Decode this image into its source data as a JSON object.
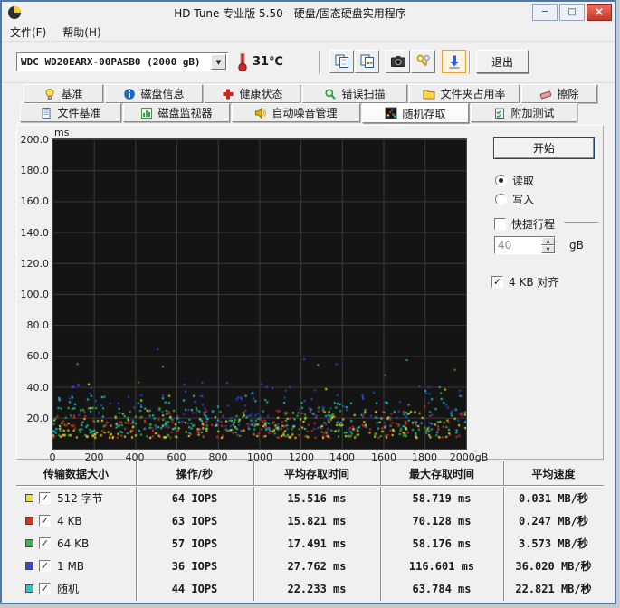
{
  "window": {
    "title": "HD Tune 专业版 5.50 - 硬盘/固态硬盘实用程序",
    "controls": {
      "minimize": "─",
      "maximize": "□",
      "close": "×"
    }
  },
  "menubar": {
    "items": [
      {
        "label": "文件(F)"
      },
      {
        "label": "帮助(H)"
      }
    ]
  },
  "toolbar": {
    "drive_selected": "WDC WD20EARX-00PASB0 (2000 gB)",
    "temperature": "31℃",
    "exit_label": "退出"
  },
  "icons": {
    "check": "✓",
    "dropdown_arrow": "▼",
    "spin_up": "▲",
    "spin_down": "▼"
  },
  "tabs": {
    "active": "随机存取",
    "row1": [
      {
        "label": "基准"
      },
      {
        "label": "磁盘信息"
      },
      {
        "label": "健康状态"
      },
      {
        "label": "错误扫描"
      },
      {
        "label": "文件夹占用率"
      },
      {
        "label": "擦除"
      }
    ],
    "row2": [
      {
        "label": "文件基准"
      },
      {
        "label": "磁盘监视器"
      },
      {
        "label": "自动噪音管理"
      },
      {
        "label": "随机存取"
      },
      {
        "label": "附加测试"
      }
    ]
  },
  "side_panel": {
    "start_label": "开始",
    "mode": "read",
    "read_label": "读取",
    "write_label": "写入",
    "short_stroke_label": "快捷行程",
    "short_stroke_checked": false,
    "capacity_value": "40",
    "capacity_unit": "gB",
    "align_label": "4 KB 对齐",
    "align_checked": true
  },
  "chart_data": {
    "type": "scatter",
    "y_unit": "ms",
    "y_max": 200,
    "y_grid_step_ms": 20,
    "x_max_gb": 2000,
    "x_grid_step_gb": 200,
    "y_ticks": [
      "200.0",
      "180.0",
      "160.0",
      "140.0",
      "120.0",
      "100.0",
      "80.0",
      "60.0",
      "40.0",
      "20.0"
    ],
    "x_ticks": [
      "0",
      "200",
      "400",
      "600",
      "800",
      "1000",
      "1200",
      "1400",
      "1600",
      "1800",
      "2000gB"
    ],
    "draw_order": [
      3,
      2,
      4,
      1,
      0
    ],
    "series": [
      {
        "name": "512 字节",
        "color": "#f2e11c",
        "avg_ms": 15.516,
        "max_ms": 58.719,
        "points": 170
      },
      {
        "name": "4 KB",
        "color": "#e22d1c",
        "avg_ms": 15.821,
        "max_ms": 70.128,
        "points": 160
      },
      {
        "name": "64 KB",
        "color": "#2fbe47",
        "avg_ms": 17.491,
        "max_ms": 58.176,
        "points": 160
      },
      {
        "name": "1 MB",
        "color": "#3346dd",
        "avg_ms": 27.762,
        "max_ms": 116.601,
        "points": 150
      },
      {
        "name": "随机",
        "color": "#17cfcf",
        "avg_ms": 22.233,
        "max_ms": 63.784,
        "points": 160
      }
    ]
  },
  "table": {
    "headers": [
      "传输数据大小",
      "操作/秒",
      "平均存取时间",
      "最大存取时间",
      "平均速度"
    ],
    "rows": [
      {
        "color": "#f2e11c",
        "label": "512 字节",
        "checked": true,
        "ops": "64 IOPS",
        "avg": "15.516 ms",
        "max": "58.719 ms",
        "speed": "0.031 MB/秒"
      },
      {
        "color": "#e22d1c",
        "label": "4 KB",
        "checked": true,
        "ops": "63 IOPS",
        "avg": "15.821 ms",
        "max": "70.128 ms",
        "speed": "0.247 MB/秒"
      },
      {
        "color": "#2fbe47",
        "label": "64 KB",
        "checked": true,
        "ops": "57 IOPS",
        "avg": "17.491 ms",
        "max": "58.176 ms",
        "speed": "3.573 MB/秒"
      },
      {
        "color": "#3346dd",
        "label": "1 MB",
        "checked": true,
        "ops": "36 IOPS",
        "avg": "27.762 ms",
        "max": "116.601 ms",
        "speed": "36.020 MB/秒"
      },
      {
        "color": "#17cfcf",
        "label": "随机",
        "checked": true,
        "ops": "44 IOPS",
        "avg": "22.233 ms",
        "max": "63.784 ms",
        "speed": "22.821 MB/秒"
      }
    ]
  }
}
